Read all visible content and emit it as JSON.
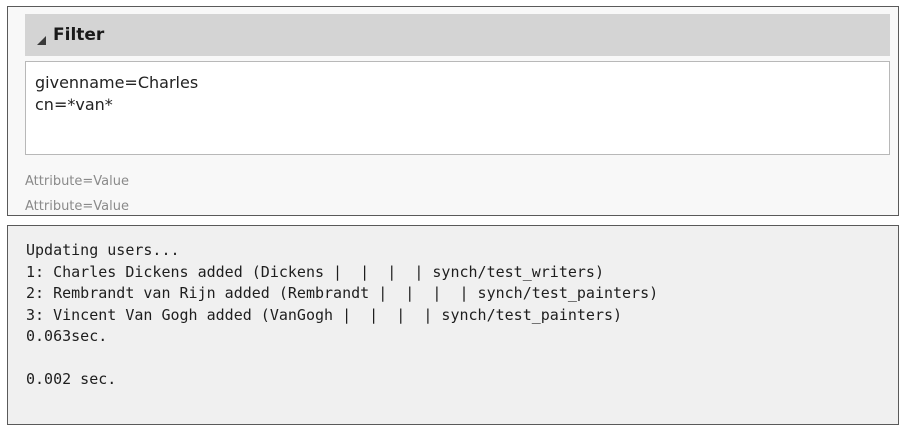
{
  "filter": {
    "title": "Filter",
    "collapse_icon": "collapse-triangle-icon",
    "lines": [
      "givenname=Charles",
      "cn=*van*"
    ],
    "hints": [
      "Attribute=Value",
      "Attribute=Value"
    ]
  },
  "console": {
    "lines": [
      "Updating users...",
      "1: Charles Dickens added (Dickens |  |  |  | synch/test_writers)",
      "2: Rembrandt van Rijn added (Rembrandt |  |  |  | synch/test_painters)",
      "3: Vincent Van Gogh added (VanGogh |  |  |  | synch/test_painters)",
      "0.063sec.",
      "",
      "0.002 sec."
    ]
  }
}
